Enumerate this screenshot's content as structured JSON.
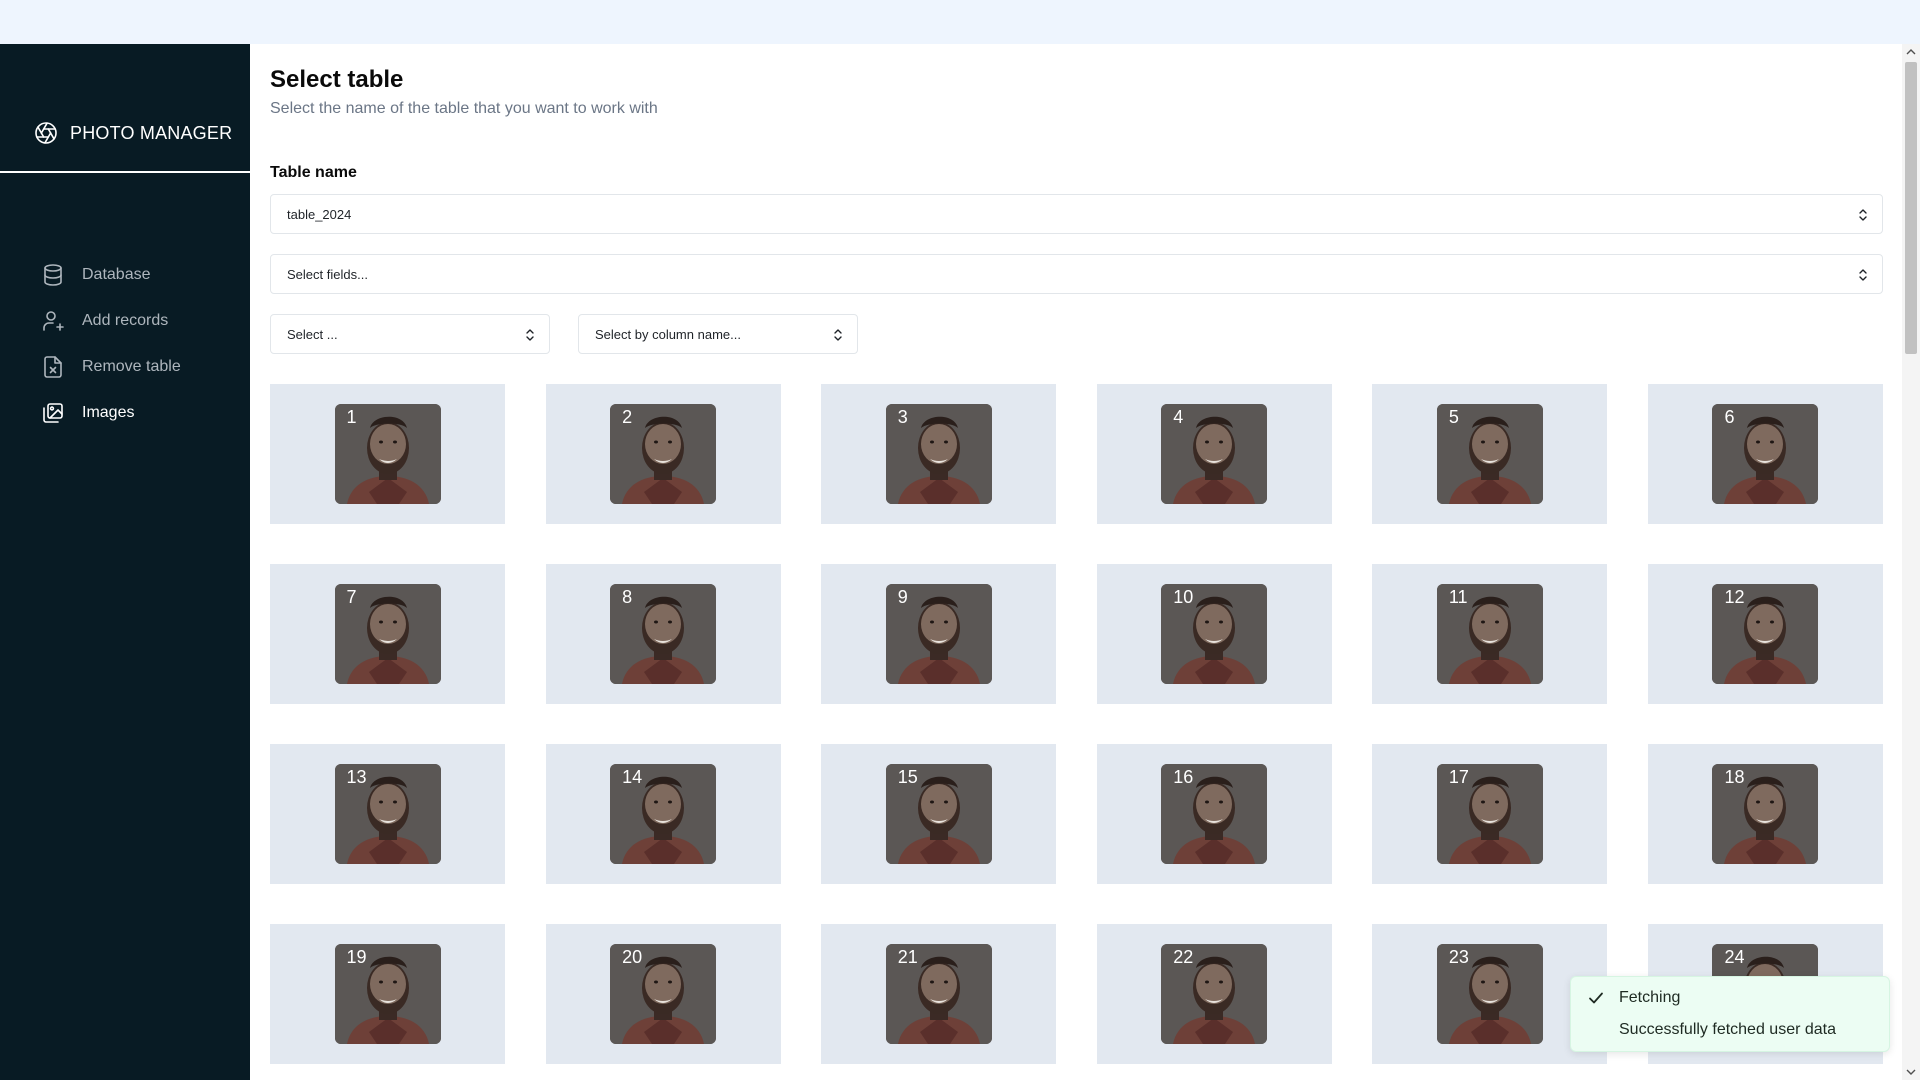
{
  "app": {
    "brand": "PHOTO MANAGER"
  },
  "sidebar": {
    "items": [
      {
        "label": "Database",
        "icon": "database-icon",
        "active": false
      },
      {
        "label": "Add records",
        "icon": "user-plus-icon",
        "active": false
      },
      {
        "label": "Remove table",
        "icon": "file-x-icon",
        "active": false
      },
      {
        "label": "Images",
        "icon": "images-icon",
        "active": true
      }
    ]
  },
  "main": {
    "title": "Select table",
    "subtitle": "Select the name of the table that you want to work with",
    "table_label": "Table name",
    "table_value": "table_2024",
    "fields_placeholder": "Select fields...",
    "select_placeholder": "Select ...",
    "column_placeholder": "Select by column name..."
  },
  "images": [
    "1",
    "2",
    "3",
    "4",
    "5",
    "6",
    "7",
    "8",
    "9",
    "10",
    "11",
    "12",
    "13",
    "14",
    "15",
    "16",
    "17",
    "18",
    "19",
    "20",
    "21",
    "22",
    "23",
    "24"
  ],
  "toast": {
    "title": "Fetching",
    "message": "Successfully fetched user data",
    "icon": "check-icon"
  },
  "colors": {
    "sidebar_bg": "#081b24",
    "topbar_bg": "#eef5fe",
    "card_bg": "#e2e8f0",
    "toast_bg": "#ecfdf3"
  }
}
